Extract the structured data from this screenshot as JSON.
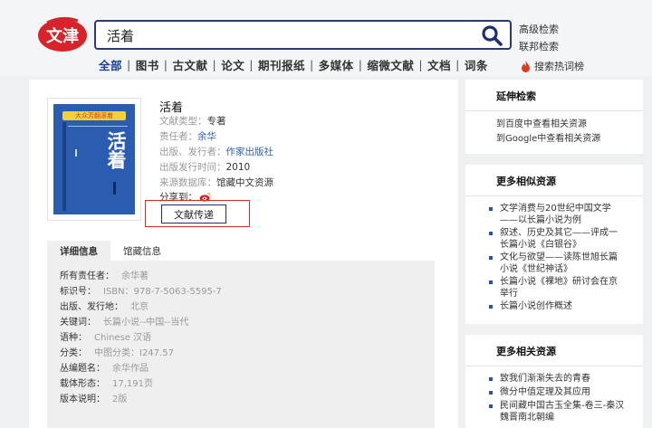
{
  "header": {
    "logo_text": "文津",
    "search_value": "活着",
    "advanced_search": "高级检索",
    "federated_search": "联邦检索",
    "hot_words": "搜索热词榜",
    "nav": [
      "全部",
      "图书",
      "古文献",
      "论文",
      "期刊报纸",
      "多媒体",
      "缩微文献",
      "文档",
      "词条"
    ]
  },
  "book": {
    "title": "活着",
    "cover_title": "活着",
    "cover_banner": "大众芳翻滚着",
    "fields": [
      {
        "label": "文献类型：",
        "value": "专著",
        "style": "v"
      },
      {
        "label": "责任者：",
        "value": "余华",
        "style": "link"
      },
      {
        "label": "出版、发行者：",
        "value": "作家出版社",
        "style": "link"
      },
      {
        "label": "出版发行时间：",
        "value": "2010",
        "style": "v"
      },
      {
        "label": "来源数据库：",
        "value": "馆藏中文资源",
        "style": "v"
      }
    ],
    "share_label": "分享到：",
    "deliver_button": "文献传递"
  },
  "tabs": [
    "详细信息",
    "馆藏信息"
  ],
  "details": [
    {
      "label": "所有责任者：",
      "value": "余华著"
    },
    {
      "label": "标识号：",
      "value": "ISBN：978-7-5063-5595-7"
    },
    {
      "label": "出版、发行地：",
      "value": "北京"
    },
    {
      "label": "关键词：",
      "value": "长篇小说--中国--当代"
    },
    {
      "label": "语种：",
      "value": "Chinese 汉语"
    },
    {
      "label": "分类：",
      "value": "中图分类：I247.57"
    },
    {
      "label": "丛编题名：",
      "value": "余华作品"
    },
    {
      "label": "载体形态：",
      "value": "17,191页"
    },
    {
      "label": "版本说明：",
      "value": "2版"
    }
  ],
  "sidebar": {
    "extend": {
      "title": "延伸检索",
      "links": [
        "到百度中查看相关资源",
        "到Google中查看相关资源"
      ]
    },
    "similar": {
      "title": "更多相似资源",
      "items": [
        "文学消费与20世纪中国文学——以长篇小说为例",
        "叙述、历史及其它——评成一长篇小说《白银谷》",
        "文化与欲望——读陈世旭长篇小说《世纪神话》",
        "长篇小说《裸地》研讨会在京举行",
        "长篇小说创作概述"
      ]
    },
    "related": {
      "title": "更多相关资源",
      "items": [
        "致我们渐渐失去的青春",
        "微分中值定理及其应用",
        "民间藏中国古玉全集-卷三-秦汉魏晋南北朝编"
      ]
    }
  },
  "colors": {
    "brand_red": "#d8232a",
    "navy": "#1d2f6f",
    "link_blue": "#3060b0"
  }
}
